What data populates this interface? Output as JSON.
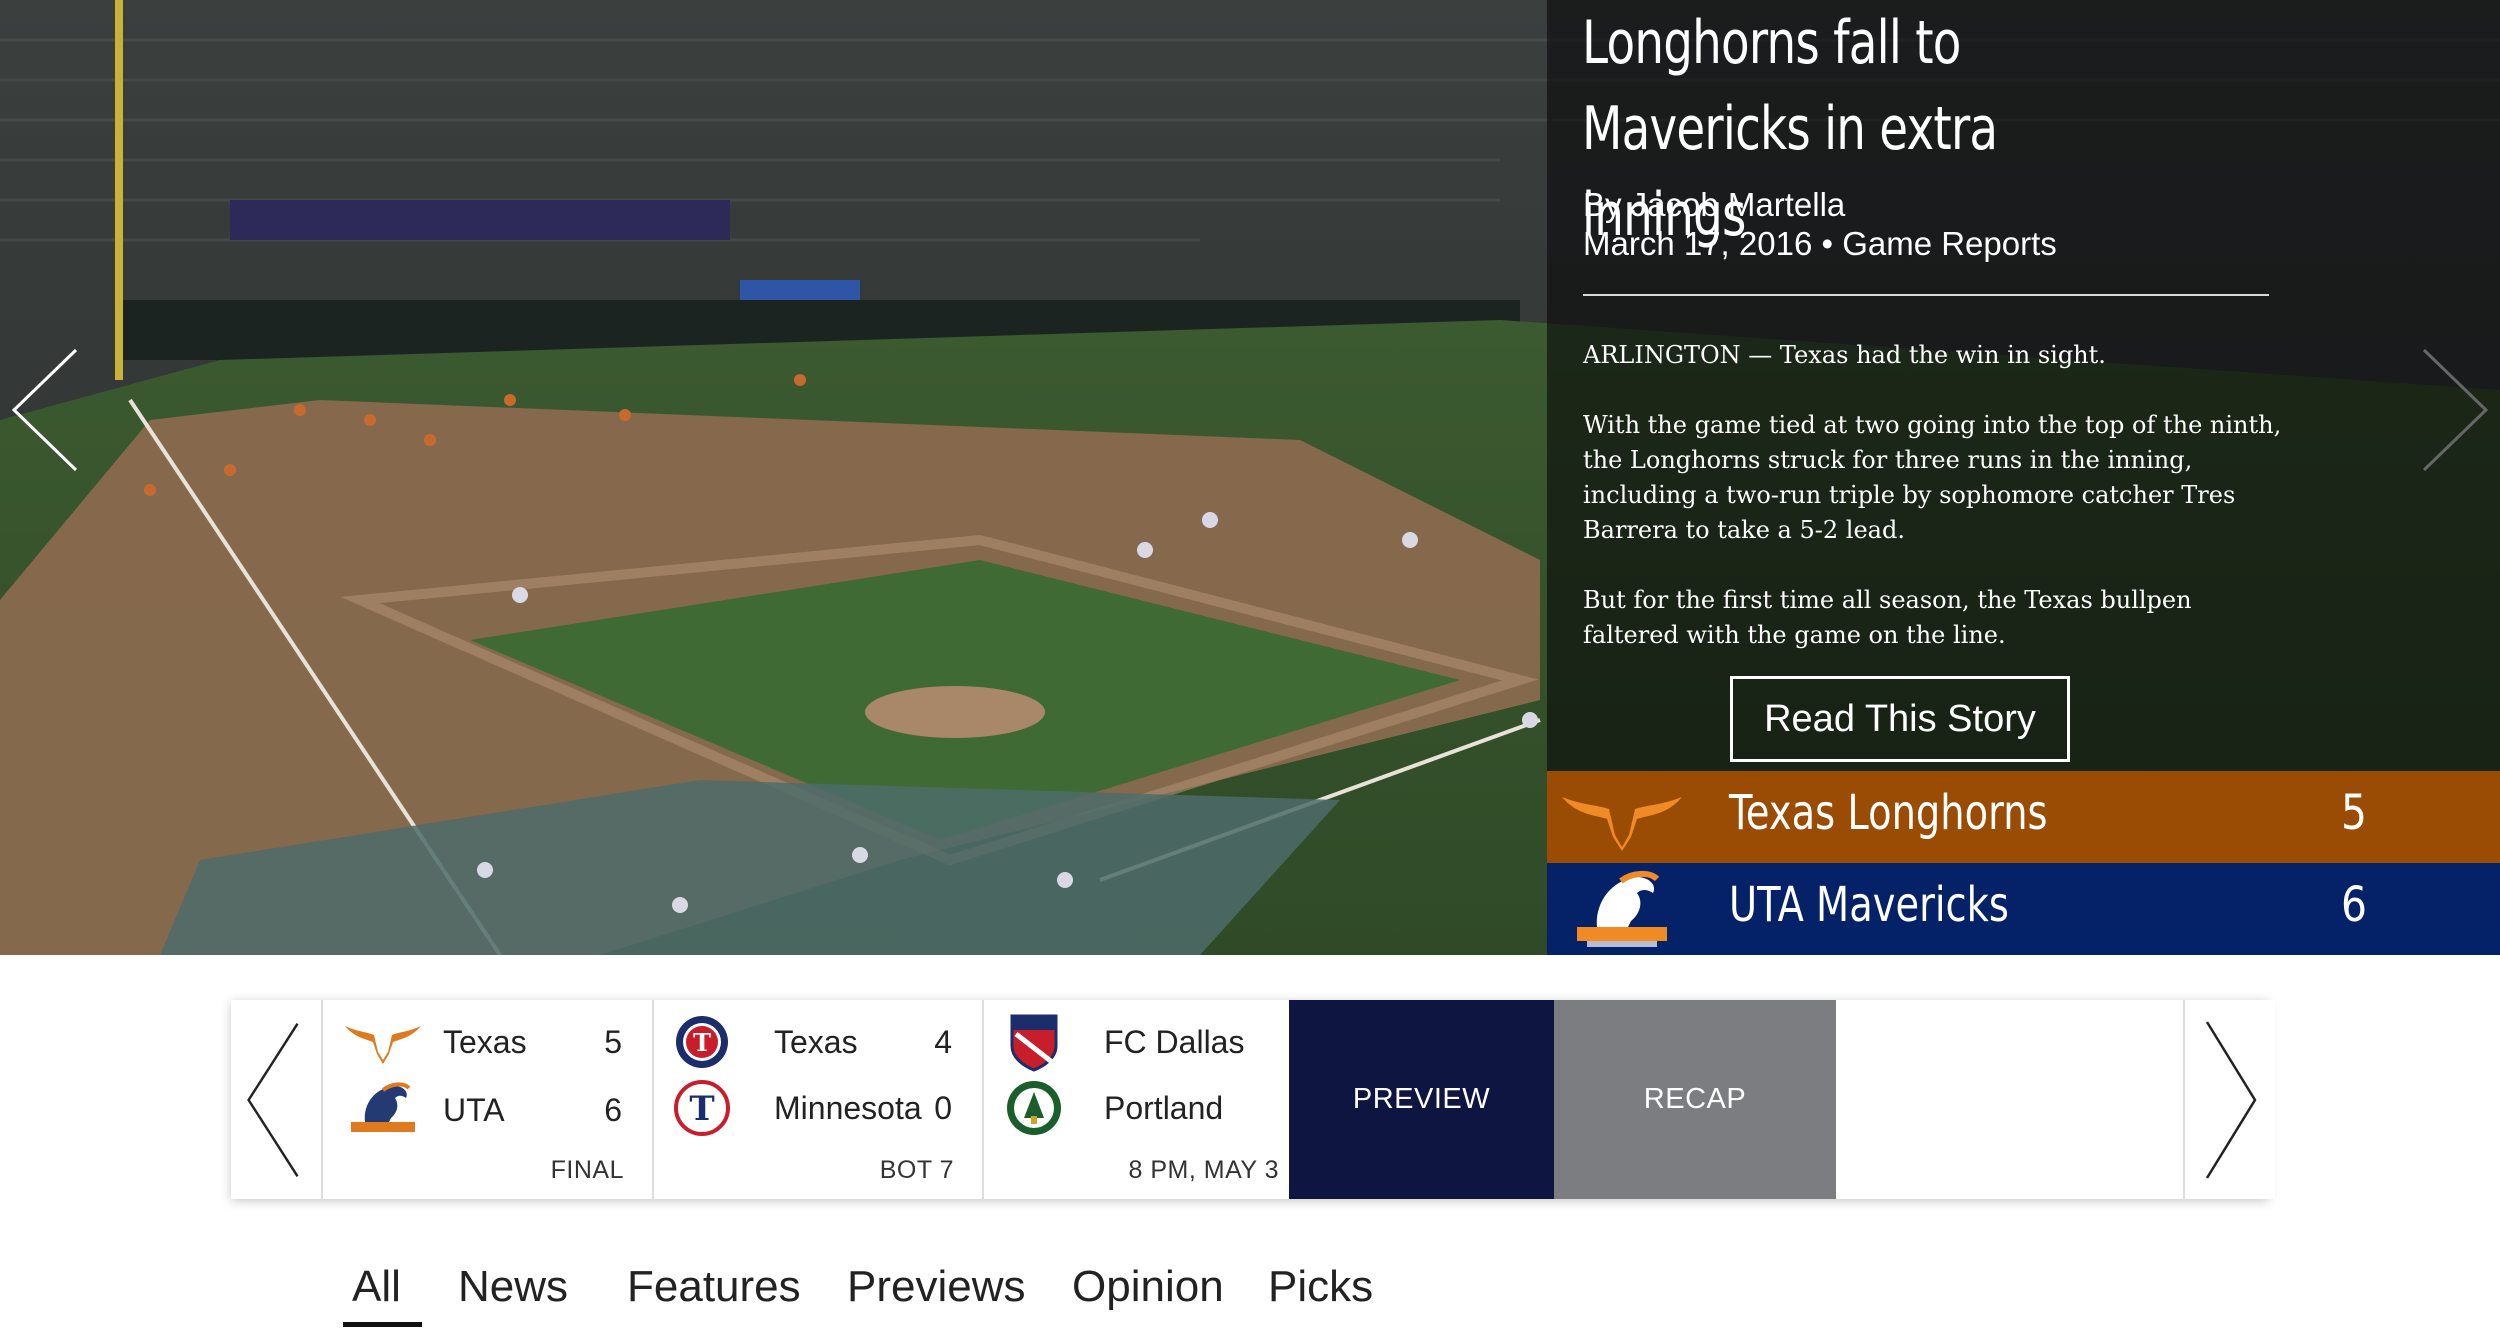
{
  "hero": {
    "story": {
      "title_line1": "Longhorns fall to",
      "title_line2": "Mavericks in extra innings",
      "author": "By Jacob Martella",
      "date_category": "March 17, 2016 • Game Reports",
      "paragraphs": [
        "ARLINGTON — Texas had the win in sight.",
        "With the game tied at two going into the top of the ninth, the Longhorns struck for three runs in the inning, including a two-run triple by sophomore catcher Tres Barrera to take a 5-2 lead.",
        "But for the first time all season, the Texas bullpen faltered with the game on the line."
      ],
      "read_button": "Read This Story"
    },
    "scoreboard": [
      {
        "team": "Texas Longhorns",
        "score": "5",
        "color": "#bf5700"
      },
      {
        "team": "UTA Mavericks",
        "score": "6",
        "color": "#002280"
      }
    ]
  },
  "scores_strip": {
    "games": [
      {
        "teams": [
          {
            "name": "Texas",
            "score": "5",
            "logo": "longhorn-icon"
          },
          {
            "name": "UTA",
            "score": "6",
            "logo": "mavericks-icon"
          }
        ],
        "status": "FINAL"
      },
      {
        "teams": [
          {
            "name": "Texas",
            "score": "4",
            "logo": "rangers-icon"
          },
          {
            "name": "Minnesota",
            "score": "0",
            "logo": "twins-icon"
          }
        ],
        "status": "BOT 7"
      },
      {
        "teams": [
          {
            "name": "FC Dallas",
            "score": "",
            "logo": "fc-dallas-icon"
          },
          {
            "name": "Portland",
            "score": "",
            "logo": "portland-timbers-icon"
          }
        ],
        "status": "8 PM, MAY 3"
      }
    ],
    "preview_label": "PREVIEW",
    "recap_label": "RECAP"
  },
  "tabs": [
    {
      "label": "All",
      "active": true
    },
    {
      "label": "News"
    },
    {
      "label": "Features"
    },
    {
      "label": "Previews"
    },
    {
      "label": "Opinion"
    },
    {
      "label": "Picks"
    }
  ],
  "colors": {
    "texas_orange": "#bf5700",
    "uta_blue": "#002280",
    "preview_navy": "#0f1541",
    "recap_gray": "#7c7d80"
  }
}
